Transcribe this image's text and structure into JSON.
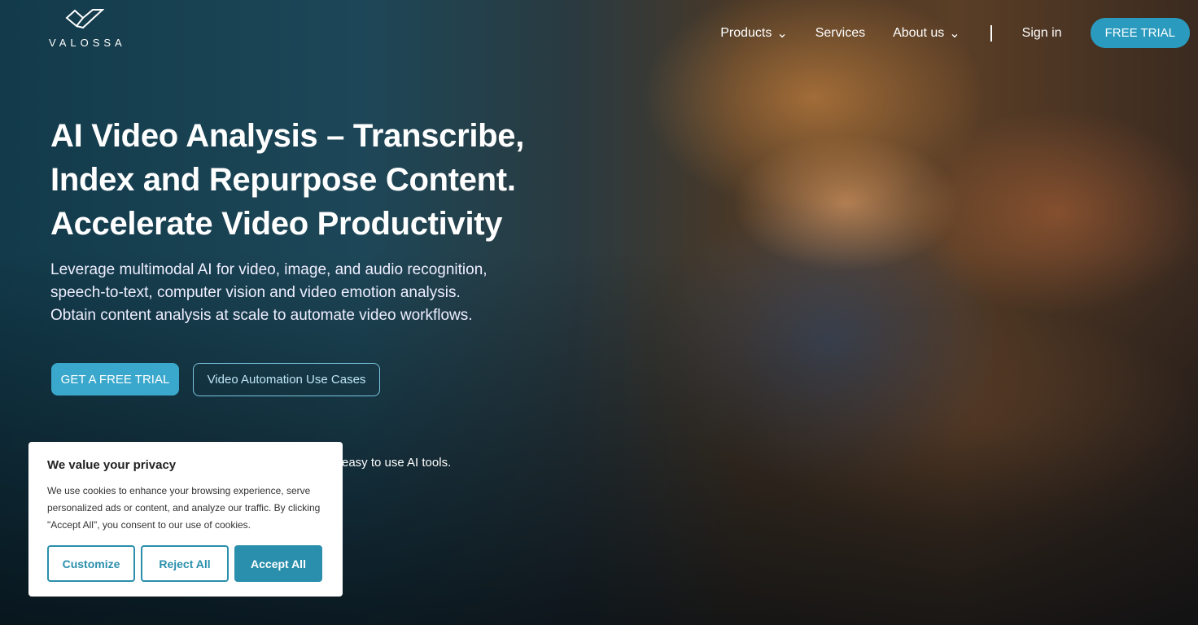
{
  "brand": {
    "name": "VALOSSA"
  },
  "nav": {
    "items": [
      "Products",
      "Services",
      "About us"
    ],
    "sign_in": "Sign in",
    "free_trial": "FREE TRIAL"
  },
  "hero": {
    "title_lines": [
      "AI Video Analysis – Transcribe,",
      "Index and Repurpose Content.",
      "Accelerate Video Productivity"
    ],
    "lead_lines": [
      "Leverage multimodal AI for video, image, and audio recognition,",
      "speech-to-text, computer vision and video emotion analysis.",
      "Obtain content analysis at scale to automate video workflows."
    ],
    "cta_primary": "GET A FREE TRIAL",
    "cta_secondary": "Video Automation Use Cases",
    "partial_text": "easy to use AI tools."
  },
  "cookie": {
    "title": "We value your privacy",
    "body": "We use cookies to enhance your browsing experience, serve personalized ads or content, and analyze our traffic. By clicking \"Accept All\", you consent to our use of cookies.",
    "customize": "Customize",
    "reject": "Reject All",
    "accept": "Accept All"
  },
  "colors": {
    "accent": "#2a9bbf",
    "cookie_button": "#2a8fac"
  }
}
